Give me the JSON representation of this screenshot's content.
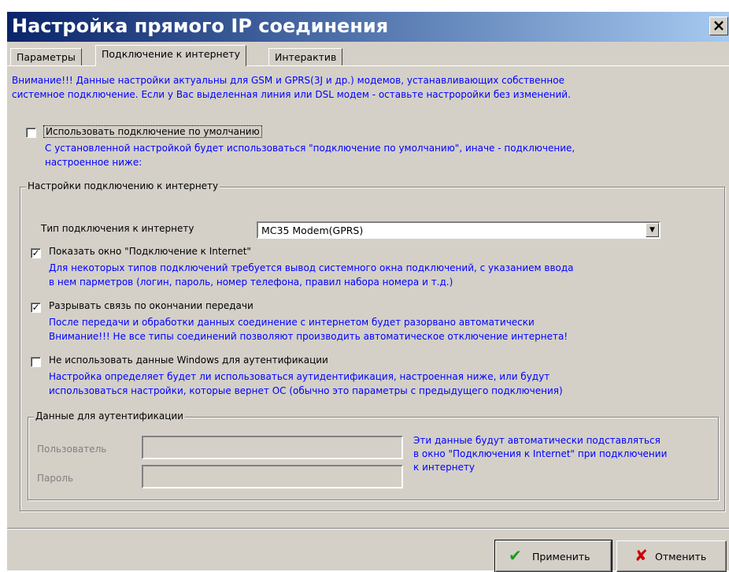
{
  "window": {
    "title": "Настройка прямого IP соединения",
    "close_glyph": "×"
  },
  "tabs": [
    {
      "label": "Параметры",
      "active": false
    },
    {
      "label": "Подключение к интернету",
      "active": true
    },
    {
      "label": "Интерактив",
      "active": false
    }
  ],
  "notice": {
    "line1": "Внимание!!! Данные настройки актуальны для GSM и GPRS(3J и др.) модемов, устанавливающих собственное",
    "line2": "системное подключение. Если у Вас выделенная линия или DSL модем - оставьте настроройки без изменений."
  },
  "default_connection": {
    "label": "Использовать подключение по умолчанию",
    "checked": false,
    "desc1": "С установленной настройкой будет использоваться \"подключение по умолчанию\", иначе - подключение,",
    "desc2": "настроенное ниже:"
  },
  "internet_group": {
    "legend": "Настройки подключению к интернету",
    "type_label": "Тип подключения к интернету",
    "type_value": "MC35 Modem(GPRS)",
    "show_window": {
      "label": "Показать окно \"Подключение к Internet\"",
      "checked": true,
      "desc1": "Для некоторых типов подключений требуется вывод системного окна подключений, с указанием ввода",
      "desc2": "в нем парметров (логин, пароль, номер телефона, правил набора номера и т.д.)"
    },
    "disconnect": {
      "label": "Разрывать связь по окончании передачи",
      "checked": true,
      "desc1": "После передачи и обработки данных соединение с интернетом будет разорвано автоматически",
      "desc2": "Внимание!!! Не все типы соединений позволяют производить автоматическое отключение интернета!"
    },
    "no_windows_auth": {
      "label": "Не использовать данные Windows для аутентификации",
      "checked": false,
      "desc1": "Настройка определяет будет ли использоваться аутидентификация, настроенная ниже, или будут",
      "desc2": " использоваться настройки, которые вернет ОС (обычно это параметры с предыдущего подключения)"
    },
    "auth_group": {
      "legend": "Данные для аутентификации",
      "user_label": "Пользователь",
      "password_label": "Пароль",
      "user_value": "",
      "password_value": "",
      "hint1": "Эти данные будут автоматически подставляться",
      "hint2": "в окно \"Подключения к Internet\" при подключении",
      "hint3": "к интернету"
    }
  },
  "buttons": {
    "apply_label": "Применить",
    "apply_icon": "✔",
    "cancel_label": "Отменить",
    "cancel_icon": "✘"
  },
  "colors": {
    "info_text": "#0000ff",
    "apply_icon": "#1a9a1a",
    "cancel_icon": "#cc0000"
  }
}
